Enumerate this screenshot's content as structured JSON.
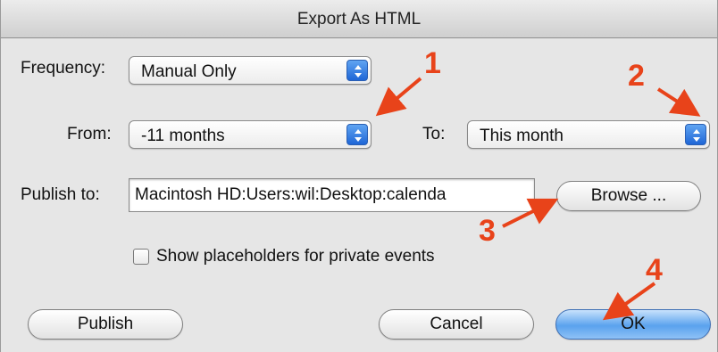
{
  "dialog": {
    "title": "Export As HTML"
  },
  "frequency": {
    "label": "Frequency:",
    "value": "Manual Only"
  },
  "range": {
    "from_label": "From:",
    "from_value": "-11 months",
    "to_label": "To:",
    "to_value": "This month"
  },
  "publish_to": {
    "label": "Publish to:",
    "value": "Macintosh HD:Users:wil:Desktop:calenda"
  },
  "browse_label": "Browse ...",
  "placeholders": {
    "label": "Show placeholders for private events",
    "checked": false
  },
  "buttons": {
    "publish": "Publish",
    "cancel": "Cancel",
    "ok": "OK"
  },
  "annotations": [
    "1",
    "2",
    "3",
    "4"
  ],
  "colors": {
    "annotation": "#e8431a",
    "default_button": "#5aa2ee",
    "stepper": "#1f66d6"
  }
}
